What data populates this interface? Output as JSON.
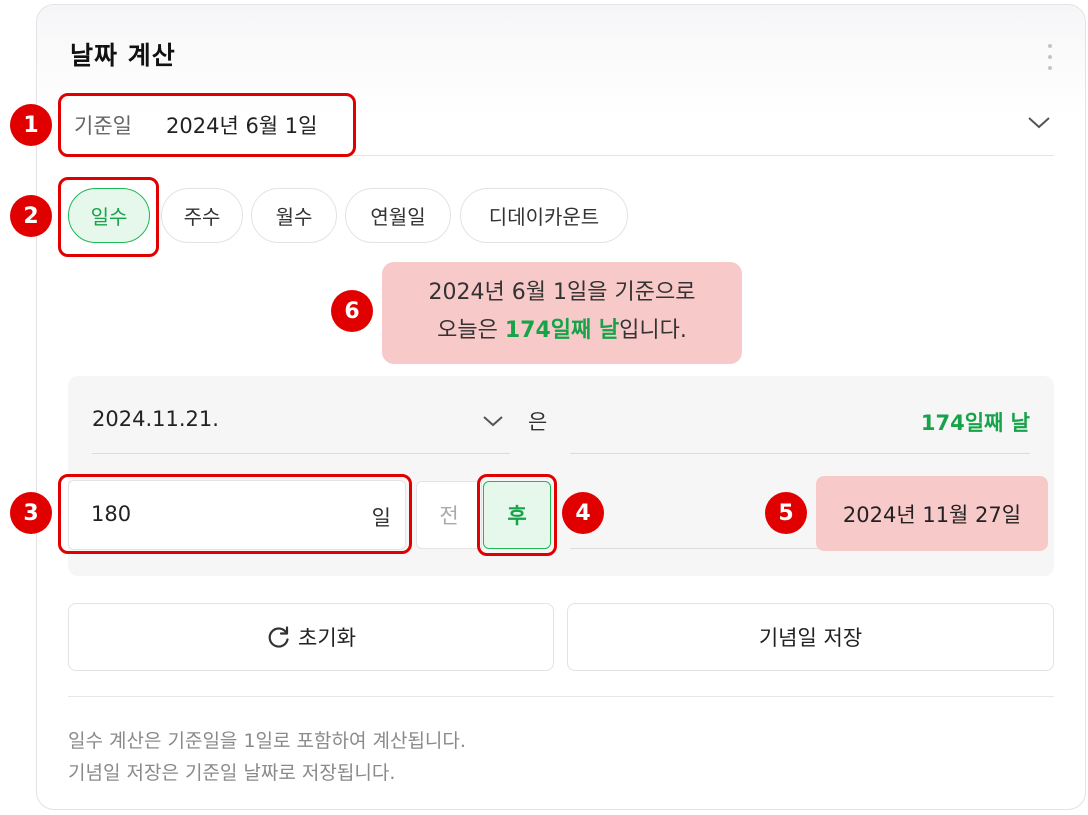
{
  "header": {
    "title": "날짜 계산"
  },
  "base": {
    "label": "기준일",
    "value": "2024년 6월 1일"
  },
  "tabs": [
    {
      "label": "일수",
      "active": true
    },
    {
      "label": "주수",
      "active": false
    },
    {
      "label": "월수",
      "active": false
    },
    {
      "label": "연월일",
      "active": false
    },
    {
      "label": "디데이카운트",
      "active": false
    }
  ],
  "message": {
    "line1": "2024년 6월 1일을 기준으로",
    "line2_prefix": "오늘은 ",
    "line2_highlight": "174일째 날",
    "line2_suffix": "입니다."
  },
  "calc": {
    "target_date": "2024.11.21.",
    "connector": "은",
    "target_result": "174일째 날",
    "days_value": "180",
    "days_unit": "일",
    "before_label": "전",
    "after_label": "후",
    "offset_result": "2024년 11월 27일"
  },
  "actions": {
    "reset_label": "초기화",
    "save_label": "기념일 저장"
  },
  "notes": [
    "일수 계산은 기준일을 1일로 포함하여 계산됩니다.",
    "기념일 저장은 기준일 날짜로 저장됩니다."
  ],
  "annotations": [
    "1",
    "2",
    "3",
    "4",
    "5",
    "6"
  ],
  "colors": {
    "accent_green": "#17a34a",
    "highlight_pink": "#f8c9c9",
    "annotation_red": "#e00000"
  }
}
